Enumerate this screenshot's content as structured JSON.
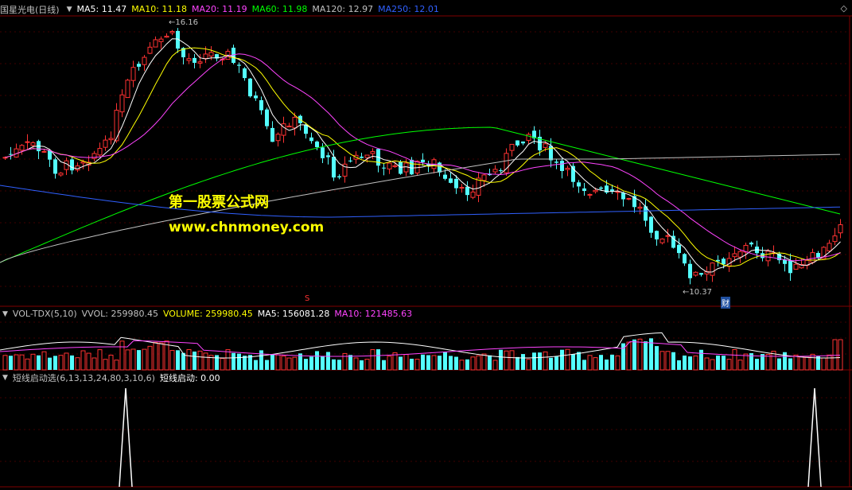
{
  "panel_main": {
    "title": "国星光电(日线)",
    "ma": [
      {
        "label": "MA5: 11.47",
        "color": "#ffffff"
      },
      {
        "label": "MA10: 11.18",
        "color": "#ffff00"
      },
      {
        "label": "MA20: 11.19",
        "color": "#ff44ff"
      },
      {
        "label": "MA60: 11.98",
        "color": "#00ff00"
      },
      {
        "label": "MA120: 12.97",
        "color": "#c0c0c0"
      },
      {
        "label": "MA250: 12.01",
        "color": "#3060ff"
      }
    ],
    "high_label": "16.16",
    "low_label": "10.37",
    "marker_s": "S",
    "marker_cai": "财"
  },
  "watermark": {
    "line1": "第一股票公式网",
    "line2": "www.chnmoney.com"
  },
  "panel_vol": {
    "title": "VOL-TDX(5,10)",
    "items": [
      {
        "label": "VVOL: 259980.45",
        "color": "#c0c0c0"
      },
      {
        "label": "VOLUME: 259980.45",
        "color": "#ffff00"
      },
      {
        "label": "MA5: 156081.28",
        "color": "#ffffff"
      },
      {
        "label": "MA10: 121485.63",
        "color": "#ff44ff"
      }
    ]
  },
  "panel_ind": {
    "title": "短线启动选(6,13,13,24,80,3,10,6)",
    "value": "短线启动: 0.00"
  },
  "colors": {
    "up": "#ff3232",
    "down": "#54ffff",
    "grid": "#800000"
  }
}
